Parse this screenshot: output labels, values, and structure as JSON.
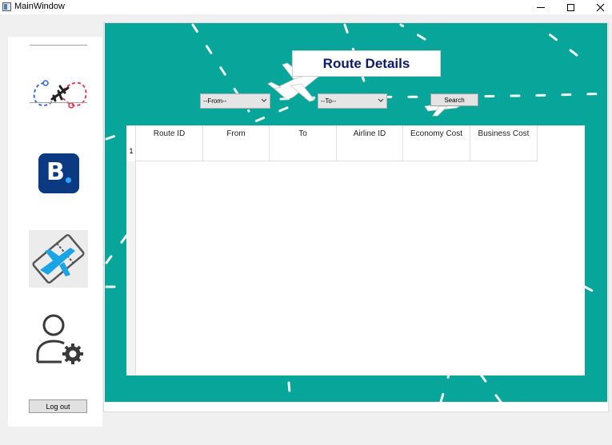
{
  "window": {
    "title": "MainWindow"
  },
  "sidebar": {
    "logout_label": "Log out"
  },
  "main": {
    "title": "Route Details",
    "from_combo": {
      "selected": "--From--"
    },
    "to_combo": {
      "selected": "--To--"
    },
    "search_label": "Search",
    "table": {
      "columns": [
        "Route ID",
        "From",
        "To",
        "Airline ID",
        "Economy Cost",
        "Business Cost"
      ],
      "row_numbers": [
        "1"
      ]
    }
  },
  "colors": {
    "accent": "#08a69a",
    "title_text": "#0a1a6e",
    "booking_blue": "#0b3a82"
  },
  "icons": [
    "app-window-icon",
    "minimize-icon",
    "maximize-icon",
    "close-icon",
    "flight-route-logo-icon",
    "booking-b-icon",
    "plane-ticket-icon",
    "user-settings-icon",
    "chevron-down-icon",
    "airplane-icon"
  ]
}
